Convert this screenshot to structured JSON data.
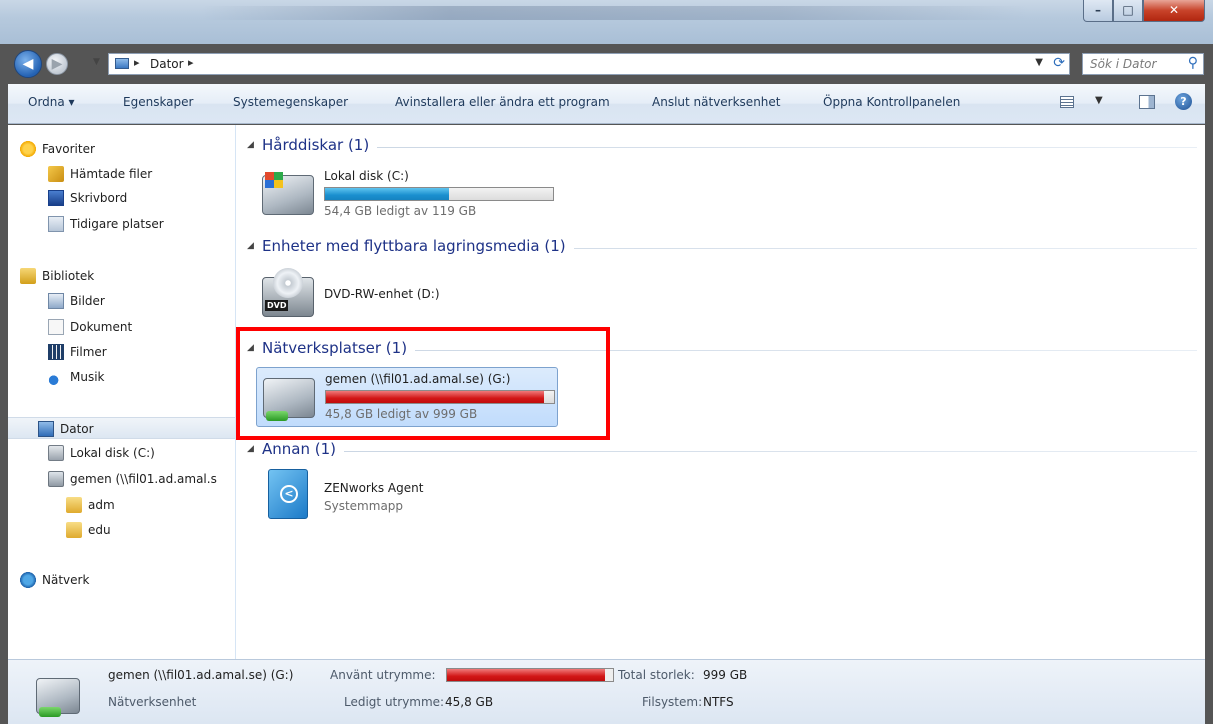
{
  "window": {
    "controls": {
      "minimize": "–",
      "maximize": "□",
      "close": "✕"
    }
  },
  "address": {
    "crumb": "Dator",
    "separator": "▸",
    "search_placeholder": "Sök i Dator"
  },
  "toolbar": {
    "items": [
      "Ordna ▾",
      "Egenskaper",
      "Systemegenskaper",
      "Avinstallera eller ändra ett program",
      "Anslut nätverksenhet",
      "Öppna Kontrollpanelen"
    ],
    "help": "?"
  },
  "nav": {
    "favorites": "Favoriter",
    "downloads": "Hämtade filer",
    "desktop": "Skrivbord",
    "recent": "Tidigare platser",
    "libraries": "Bibliotek",
    "pictures": "Bilder",
    "documents": "Dokument",
    "videos": "Filmer",
    "music": "Musik",
    "computer": "Dator",
    "local_disk": "Lokal disk (C:)",
    "network_drive": "gemen (\\\\fil01.ad.amal.s",
    "folder_adm": "adm",
    "folder_edu": "edu",
    "network": "Nätverk"
  },
  "groups": {
    "harddisks": {
      "title": "Hårddiskar (1)"
    },
    "removable": {
      "title": "Enheter med flyttbara lagringsmedia (1)"
    },
    "network": {
      "title": "Nätverksplatser (1)"
    },
    "other": {
      "title": "Annan (1)"
    }
  },
  "drives": {
    "c": {
      "name": "Lokal disk (C:)",
      "free_text": "54,4 GB ledigt av 119 GB",
      "used_fraction": 0.543
    },
    "d": {
      "name": "DVD-RW-enhet (D:)",
      "label": "DVD"
    },
    "g": {
      "name": "gemen (\\\\fil01.ad.amal.se) (G:)",
      "free_text": "45,8 GB ledigt av 999 GB",
      "used_fraction": 0.954
    },
    "zen": {
      "name": "ZENworks Agent",
      "type": "Systemmapp"
    }
  },
  "details": {
    "name": "gemen (\\\\fil01.ad.amal.se) (G:)",
    "type": "Nätverksenhet",
    "used_label": "Använt utrymme:",
    "free_label": "Ledigt utrymme:",
    "free_value": "45,8 GB",
    "total_label": "Total storlek:",
    "total_value": "999 GB",
    "fs_label": "Filsystem:",
    "fs_value": "NTFS",
    "used_fraction": 0.954
  },
  "colors": {
    "highlight": "#ff0000",
    "bar_blue": "#1a8fcf",
    "bar_red": "#d21616",
    "group_title": "#1e3287"
  }
}
